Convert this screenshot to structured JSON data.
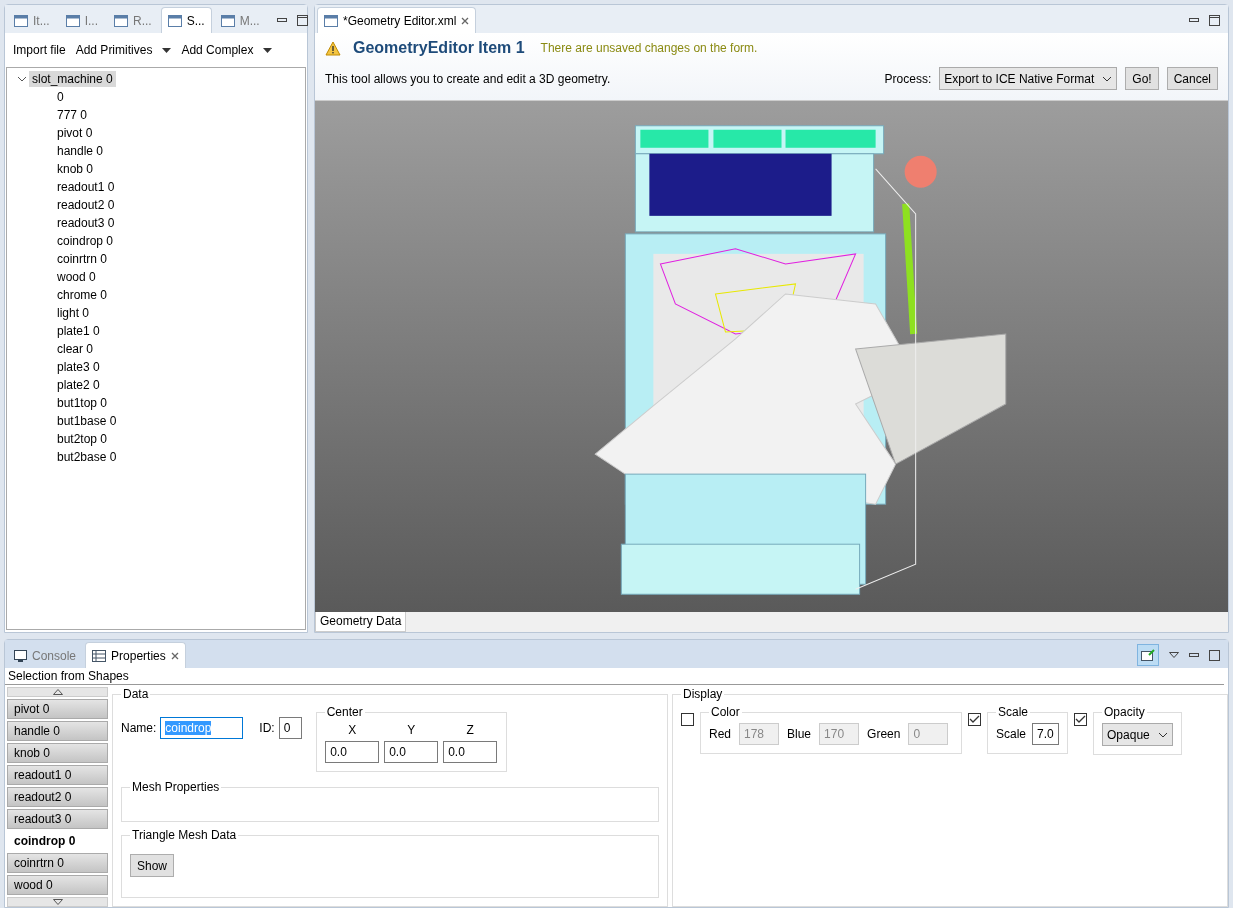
{
  "left_panel": {
    "tabs": [
      {
        "label": "It...",
        "selected": false
      },
      {
        "label": "I...",
        "selected": false
      },
      {
        "label": "R...",
        "selected": false
      },
      {
        "label": "S...",
        "selected": true
      },
      {
        "label": "M...",
        "selected": false
      }
    ],
    "toolbar": [
      {
        "label": "Import file",
        "kind": "button"
      },
      {
        "label": "Add Primitives",
        "kind": "dropdown"
      },
      {
        "label": "Add Complex",
        "kind": "dropdown"
      }
    ],
    "tree": [
      {
        "label": "slot_machine 0",
        "selected": true,
        "expanded": true,
        "children": [
          {
            "label": "0"
          },
          {
            "label": "777 0"
          },
          {
            "label": "pivot 0"
          },
          {
            "label": "handle 0"
          },
          {
            "label": "knob 0"
          },
          {
            "label": "readout1 0"
          },
          {
            "label": "readout2 0"
          },
          {
            "label": "readout3 0"
          },
          {
            "label": "coindrop 0"
          },
          {
            "label": "coinrtrn 0"
          },
          {
            "label": "wood 0"
          },
          {
            "label": "chrome 0"
          },
          {
            "label": "light 0"
          },
          {
            "label": "plate1 0"
          },
          {
            "label": "clear 0"
          },
          {
            "label": "plate3 0"
          },
          {
            "label": "plate2 0"
          },
          {
            "label": "but1top 0"
          },
          {
            "label": "but1base 0"
          },
          {
            "label": "but2top 0"
          },
          {
            "label": "but2base 0"
          }
        ]
      }
    ]
  },
  "editor": {
    "tab": {
      "label": "*Geometry Editor.xml"
    },
    "title": "GeometryEditor Item 1",
    "warning": "There are unsaved changes on the form.",
    "description": "This tool allows you to create and edit a 3D geometry.",
    "process": {
      "label": "Process:",
      "value": "Export to ICE Native Format"
    },
    "buttons": [
      "Go!",
      "Cancel"
    ],
    "bottom_tab": "Geometry Data"
  },
  "bottom_panel": {
    "tabs": [
      {
        "label": "Console",
        "selected": false
      },
      {
        "label": "Properties",
        "selected": true
      }
    ],
    "section_label": "Selection from Shapes",
    "shapes": [
      {
        "label": "pivot 0",
        "selected": false
      },
      {
        "label": "handle 0",
        "selected": false
      },
      {
        "label": "knob 0",
        "selected": false
      },
      {
        "label": "readout1 0",
        "selected": false
      },
      {
        "label": "readout2 0",
        "selected": false
      },
      {
        "label": "readout3 0",
        "selected": false
      },
      {
        "label": "coindrop 0",
        "selected": true
      },
      {
        "label": "coinrtrn 0",
        "selected": false
      },
      {
        "label": "wood 0",
        "selected": false
      }
    ],
    "data": {
      "title": "Data",
      "name_label": "Name:",
      "name_value": "coindrop",
      "id_label": "ID:",
      "id_value": "0",
      "center": {
        "title": "Center",
        "axes": [
          {
            "label": "X",
            "value": "0.0"
          },
          {
            "label": "Y",
            "value": "0.0"
          },
          {
            "label": "Z",
            "value": "0.0"
          }
        ]
      },
      "mesh_properties": "Mesh Properties",
      "triangle_mesh": {
        "title": "Triangle Mesh Data",
        "button": "Show"
      }
    },
    "display": {
      "title": "Display",
      "color": {
        "checked": false,
        "title": "Color",
        "fields": [
          {
            "label": "Red",
            "value": "178"
          },
          {
            "label": "Blue",
            "value": "170"
          },
          {
            "label": "Green",
            "value": "0"
          }
        ]
      },
      "scale": {
        "checked": true,
        "title": "Scale",
        "label": "Scale",
        "value": "7.0"
      },
      "opacity": {
        "checked": true,
        "title": "Opacity",
        "value": "Opaque"
      }
    }
  }
}
